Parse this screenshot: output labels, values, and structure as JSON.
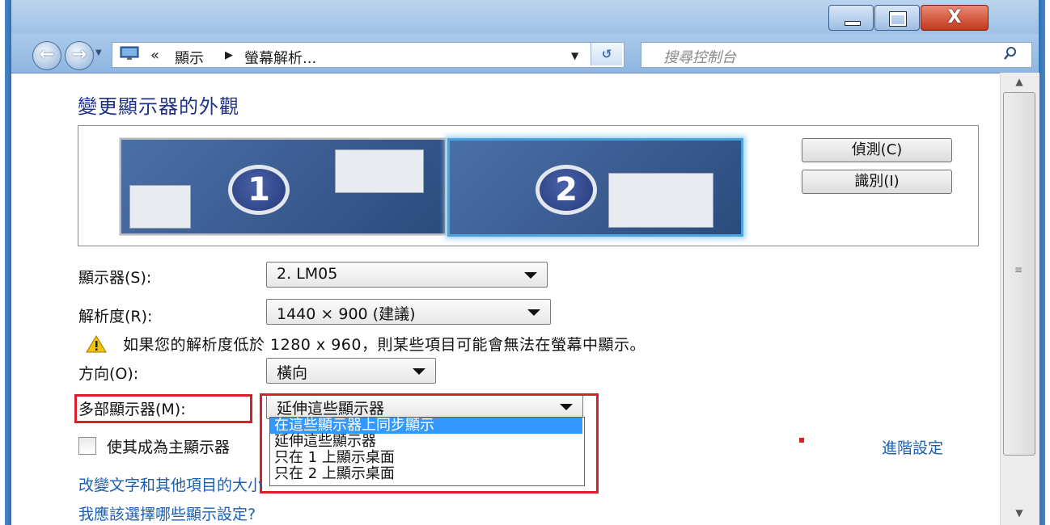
{
  "window": {
    "close_glyph": "X"
  },
  "nav": {
    "back_glyph": "←",
    "forward_glyph": "→",
    "breadcrumb_chevron": "«",
    "crumbs": [
      "顯示",
      "螢幕解析..."
    ],
    "crumb_separator": "▶",
    "refresh_glyph": "↺",
    "search_placeholder": "搜尋控制台"
  },
  "page": {
    "title": "變更顯示器的外觀",
    "monitors": [
      "1",
      "2"
    ],
    "detect_label": "偵測(C)",
    "identify_label": "識別(I)"
  },
  "form": {
    "display_label": "顯示器(S):",
    "display_value": "2. LM05",
    "resolution_label": "解析度(R):",
    "resolution_value": "1440 × 900 (建議)",
    "warning_text": "如果您的解析度低於 1280 x 960，則某些項目可能會無法在螢幕中顯示。",
    "orientation_label": "方向(O):",
    "orientation_value": "橫向",
    "multi_label": "多部顯示器(M):",
    "multi_value": "延伸這些顯示器",
    "multi_options": [
      "在這些顯示器上同步顯示",
      "延伸這些顯示器",
      "只在 1 上顯示桌面",
      "只在 2 上顯示桌面"
    ],
    "main_display_label": "使其成為主顯示器",
    "advanced_link": "進階設定",
    "link_text_size": "改變文字和其他項目的大小",
    "link_which_settings": "我應該選擇哪些顯示設定?"
  },
  "colors": {
    "highlight_red": "#d6202a",
    "selected_option": "#3399ff",
    "link_blue": "#1a5fb4",
    "title_blue": "#1e3287"
  }
}
